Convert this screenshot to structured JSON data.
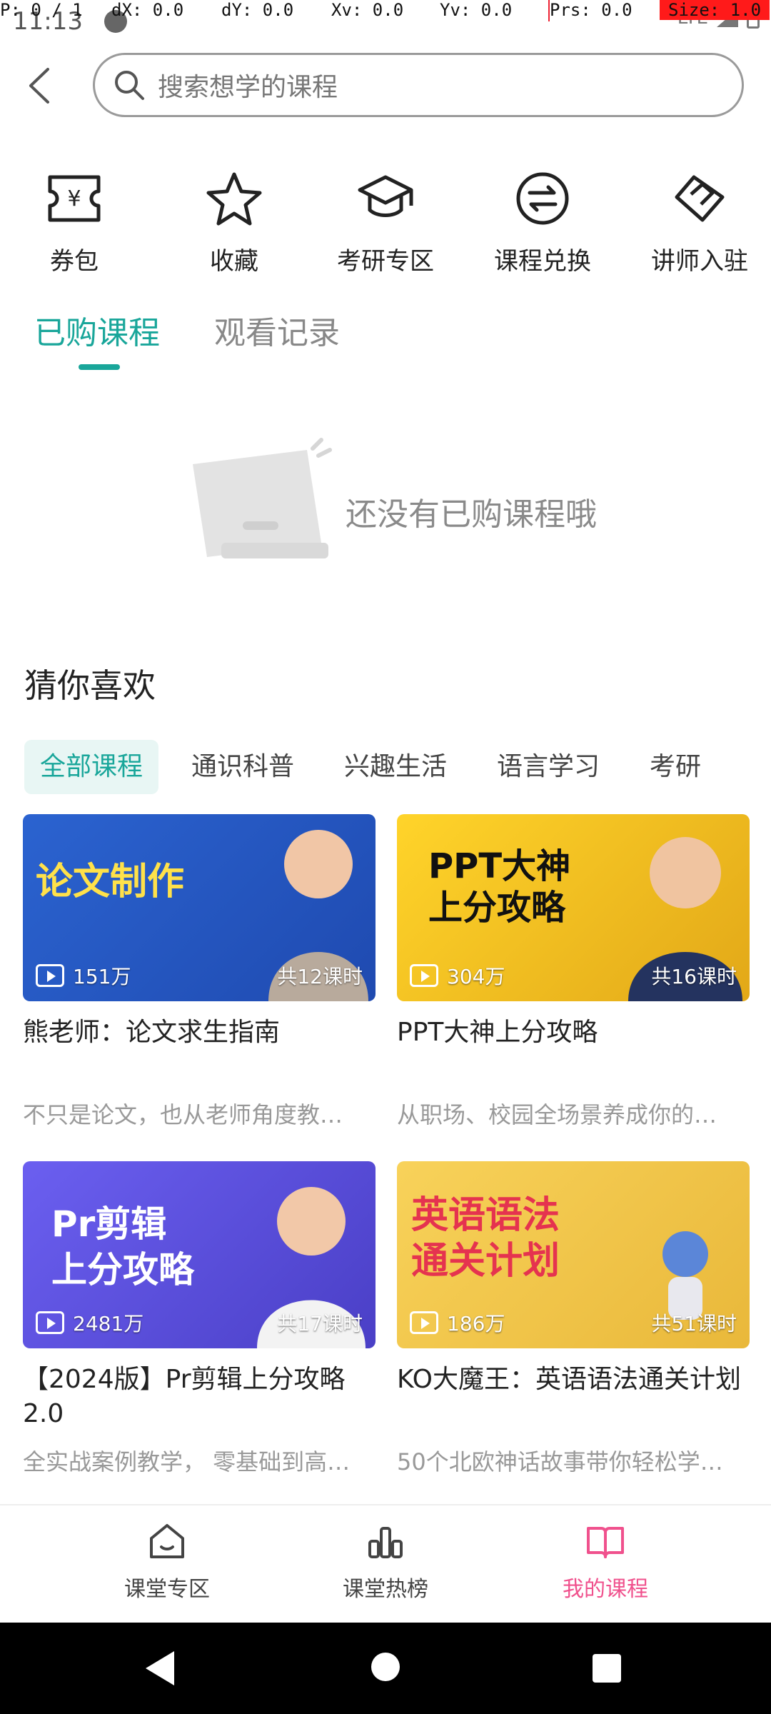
{
  "status": {
    "time": "11:13",
    "network": "LTE"
  },
  "debug": {
    "p": "P: 0 / 1",
    "dx": "dX: 0.0",
    "dy": "dY: 0.0",
    "xv": "Xv: 0.0",
    "yv": "Yv: 0.0",
    "prs": "Prs: 0.0",
    "size": "Size: 1.0"
  },
  "search": {
    "placeholder": "搜索想学的课程"
  },
  "quick_actions": [
    {
      "label": "券包",
      "icon": "coupon-icon"
    },
    {
      "label": "收藏",
      "icon": "star-icon"
    },
    {
      "label": "考研专区",
      "icon": "graduation-cap-icon"
    },
    {
      "label": "课程兑换",
      "icon": "exchange-icon"
    },
    {
      "label": "讲师入驻",
      "icon": "handshake-icon"
    }
  ],
  "tabs": {
    "purchased": "已购课程",
    "history": "观看记录"
  },
  "empty_state": {
    "text": "还没有已购课程哦"
  },
  "guess": {
    "title": "猜你喜欢",
    "categories": [
      "全部课程",
      "通识科普",
      "兴趣生活",
      "语言学习",
      "考研"
    ]
  },
  "courses": [
    {
      "title": "熊老师：论文求生指南",
      "desc": "不只是论文，也从老师角度教…",
      "views": "151万",
      "lessons": "共12课时",
      "banner": "论文制作",
      "bg": "#2b5fc9"
    },
    {
      "title": "PPT大神上分攻略",
      "desc": "从职场、校园全场景养成你的…",
      "views": "304万",
      "lessons": "共16课时",
      "banner": "PPT大神\n上分攻略",
      "bg": "#f2c51a"
    },
    {
      "title": "【2024版】Pr剪辑上分攻略2.0",
      "desc": "全实战案例教学， 零基础到高…",
      "views": "2481万",
      "lessons": "共17课时",
      "banner": "Pr剪辑\n上分攻略",
      "bg": "#5a4fd8"
    },
    {
      "title": "KO大魔王：英语语法通关计划",
      "desc": "50个北欧神话故事带你轻松学…",
      "views": "186万",
      "lessons": "共51课时",
      "banner": "英语语法\n通关计划",
      "bg": "#f3c64a"
    }
  ],
  "bottom_nav": [
    {
      "label": "课堂专区",
      "icon": "home-icon",
      "active": false
    },
    {
      "label": "课堂热榜",
      "icon": "chart-bars-icon",
      "active": false
    },
    {
      "label": "我的课程",
      "icon": "book-icon",
      "active": true
    }
  ],
  "colors": {
    "accent": "#19a69a",
    "active_nav": "#f0518d"
  }
}
